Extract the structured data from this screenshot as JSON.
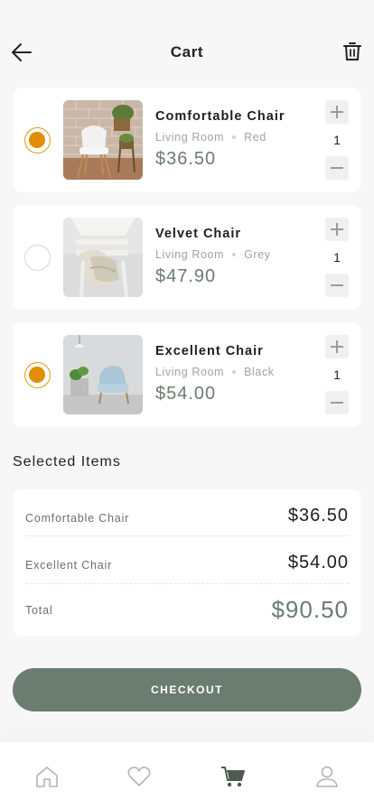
{
  "header": {
    "title": "Cart",
    "back_icon": "arrow-left-icon",
    "trash_icon": "trash-icon"
  },
  "cart": {
    "items": [
      {
        "name": "Comfortable Chair",
        "room": "Living Room",
        "color": "Red",
        "price": "$36.50",
        "quantity": "1",
        "selected": true
      },
      {
        "name": "Velvet Chair",
        "room": "Living Room",
        "color": "Grey",
        "price": "$47.90",
        "quantity": "1",
        "selected": false
      },
      {
        "name": "Excellent Chair",
        "room": "Living Room",
        "color": "Black",
        "price": "$54.00",
        "quantity": "1",
        "selected": true
      }
    ]
  },
  "summary": {
    "title": "Selected Items",
    "rows": [
      {
        "label": "Comfortable Chair",
        "value": "$36.50"
      },
      {
        "label": "Excellent Chair",
        "value": "$54.00"
      }
    ],
    "total_label": "Total",
    "total_value": "$90.50"
  },
  "checkout_label": "CHECKOUT",
  "tabbar": {
    "tabs": [
      {
        "icon": "home-icon",
        "active": false
      },
      {
        "icon": "heart-icon",
        "active": false
      },
      {
        "icon": "cart-icon",
        "active": true
      },
      {
        "icon": "profile-icon",
        "active": false
      }
    ]
  },
  "colors": {
    "accent": "#6b7c70",
    "selected_radio": "#e38c00",
    "background": "#f7f7f7"
  }
}
